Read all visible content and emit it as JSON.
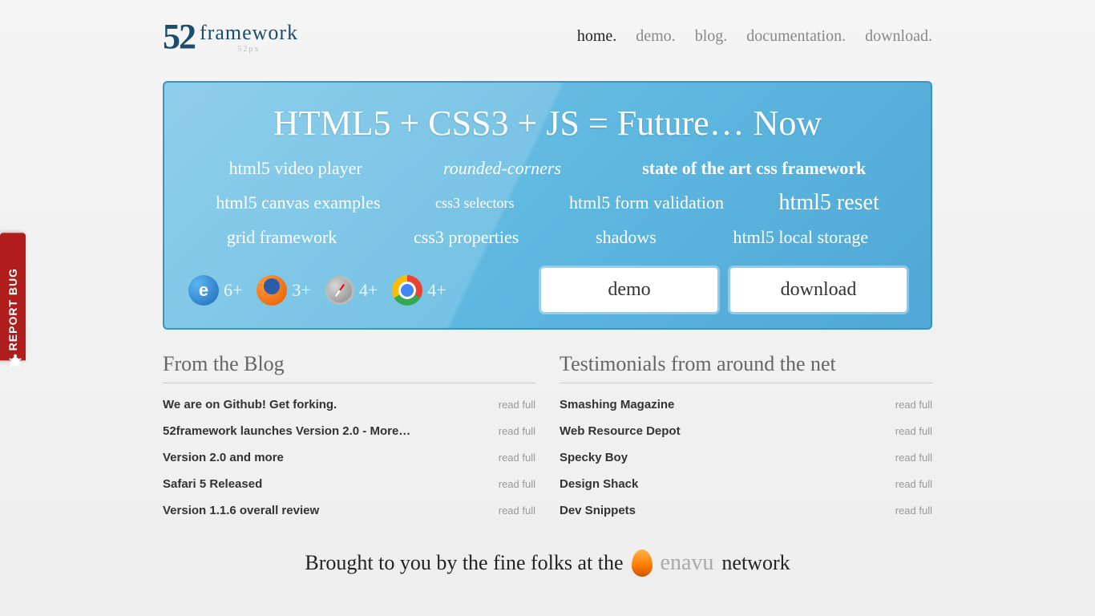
{
  "logo": {
    "number": "52",
    "text": "framework",
    "sub": "52px"
  },
  "nav": [
    {
      "label": "home.",
      "active": true
    },
    {
      "label": "demo.",
      "active": false
    },
    {
      "label": "blog.",
      "active": false
    },
    {
      "label": "documentation.",
      "active": false
    },
    {
      "label": "download.",
      "active": false
    }
  ],
  "hero": {
    "title": "HTML5  +  CSS3  + JS = Future… Now",
    "features_row1": [
      {
        "text": "html5 video player",
        "cls": ""
      },
      {
        "text": "rounded-corners",
        "cls": "italic"
      },
      {
        "text": "state of the art css framework",
        "cls": "bold"
      }
    ],
    "features_row2": [
      {
        "text": "html5 canvas examples",
        "cls": ""
      },
      {
        "text": "css3 selectors",
        "cls": "small"
      },
      {
        "text": "html5 form validation",
        "cls": ""
      },
      {
        "text": "html5 reset",
        "cls": "big"
      }
    ],
    "features_row3": [
      {
        "text": "grid framework",
        "cls": ""
      },
      {
        "text": "css3 properties",
        "cls": ""
      },
      {
        "text": "shadows",
        "cls": ""
      },
      {
        "text": "html5 local storage",
        "cls": ""
      }
    ],
    "browsers": [
      {
        "icon": "ie",
        "ver": "6+"
      },
      {
        "icon": "ff",
        "ver": "3+"
      },
      {
        "icon": "safari",
        "ver": "4+"
      },
      {
        "icon": "chrome",
        "ver": "4+"
      }
    ],
    "demo_btn": "demo",
    "download_btn": "download"
  },
  "blog": {
    "title": "From the Blog",
    "items": [
      "We are on Github! Get forking.",
      "52framework launches Version 2.0 - More…",
      "Version 2.0 and more",
      "Safari 5 Released",
      "Version 1.1.6 overall review"
    ],
    "link_label": "read full"
  },
  "testimonials": {
    "title": "Testimonials from around the net",
    "items": [
      "Smashing Magazine",
      "Web Resource Depot",
      "Specky Boy",
      "Design Shack",
      "Dev Snippets"
    ],
    "link_label": "read full"
  },
  "footer": {
    "prefix": "Brought to you by the fine folks at the",
    "brand": "enavu",
    "suffix": "network"
  },
  "report_bug": "REPORT BUG"
}
